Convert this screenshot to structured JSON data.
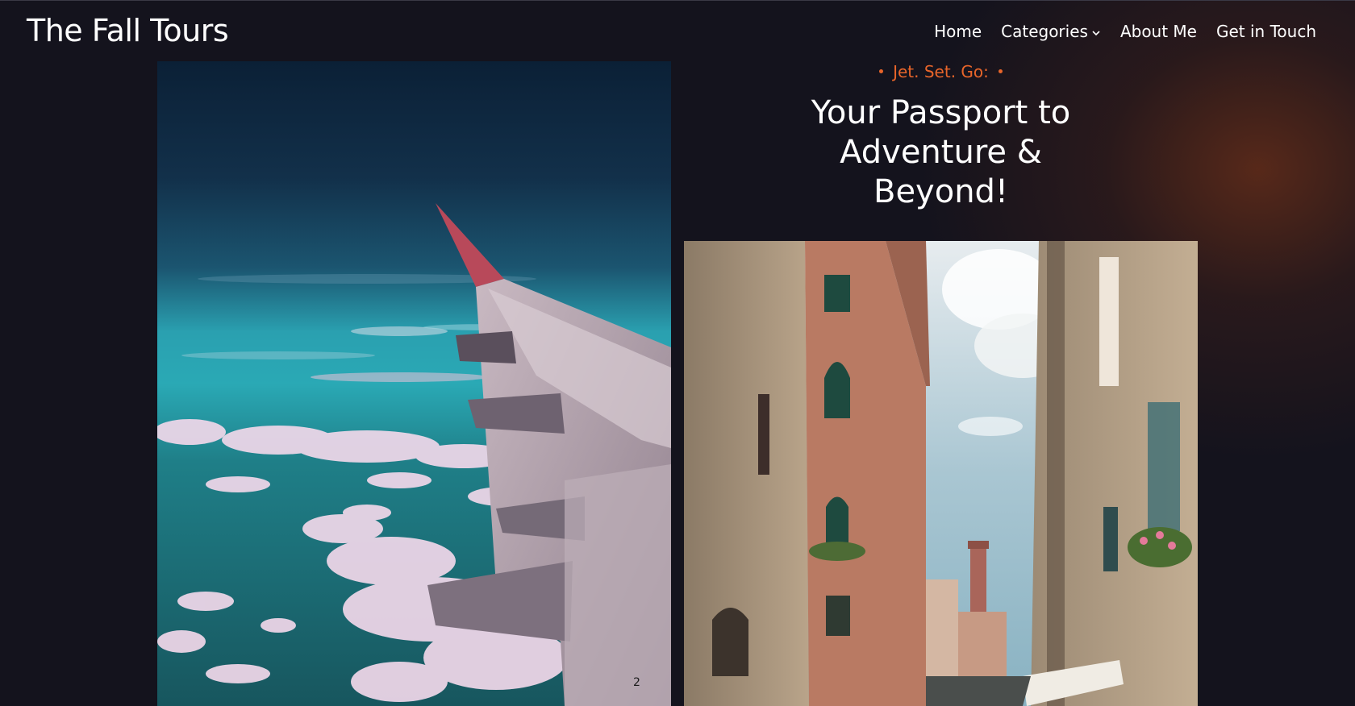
{
  "header": {
    "site_title": "The Fall Tours",
    "nav": [
      {
        "label": "Home"
      },
      {
        "label": "Categories",
        "icon": "chevron-down-icon"
      },
      {
        "label": "About Me"
      },
      {
        "label": "Get in Touch"
      }
    ]
  },
  "hero": {
    "eyebrow": "Jet. Set. Go:",
    "headline_lines": [
      "Your Passport to",
      "Adventure &",
      "Beyond!"
    ],
    "images": [
      {
        "name": "airplane-wing-over-clouds-image"
      },
      {
        "name": "venice-canal-street-image"
      }
    ]
  },
  "colors": {
    "background": "#14131d",
    "accent": "#e8652a",
    "text": "#ffffff"
  }
}
